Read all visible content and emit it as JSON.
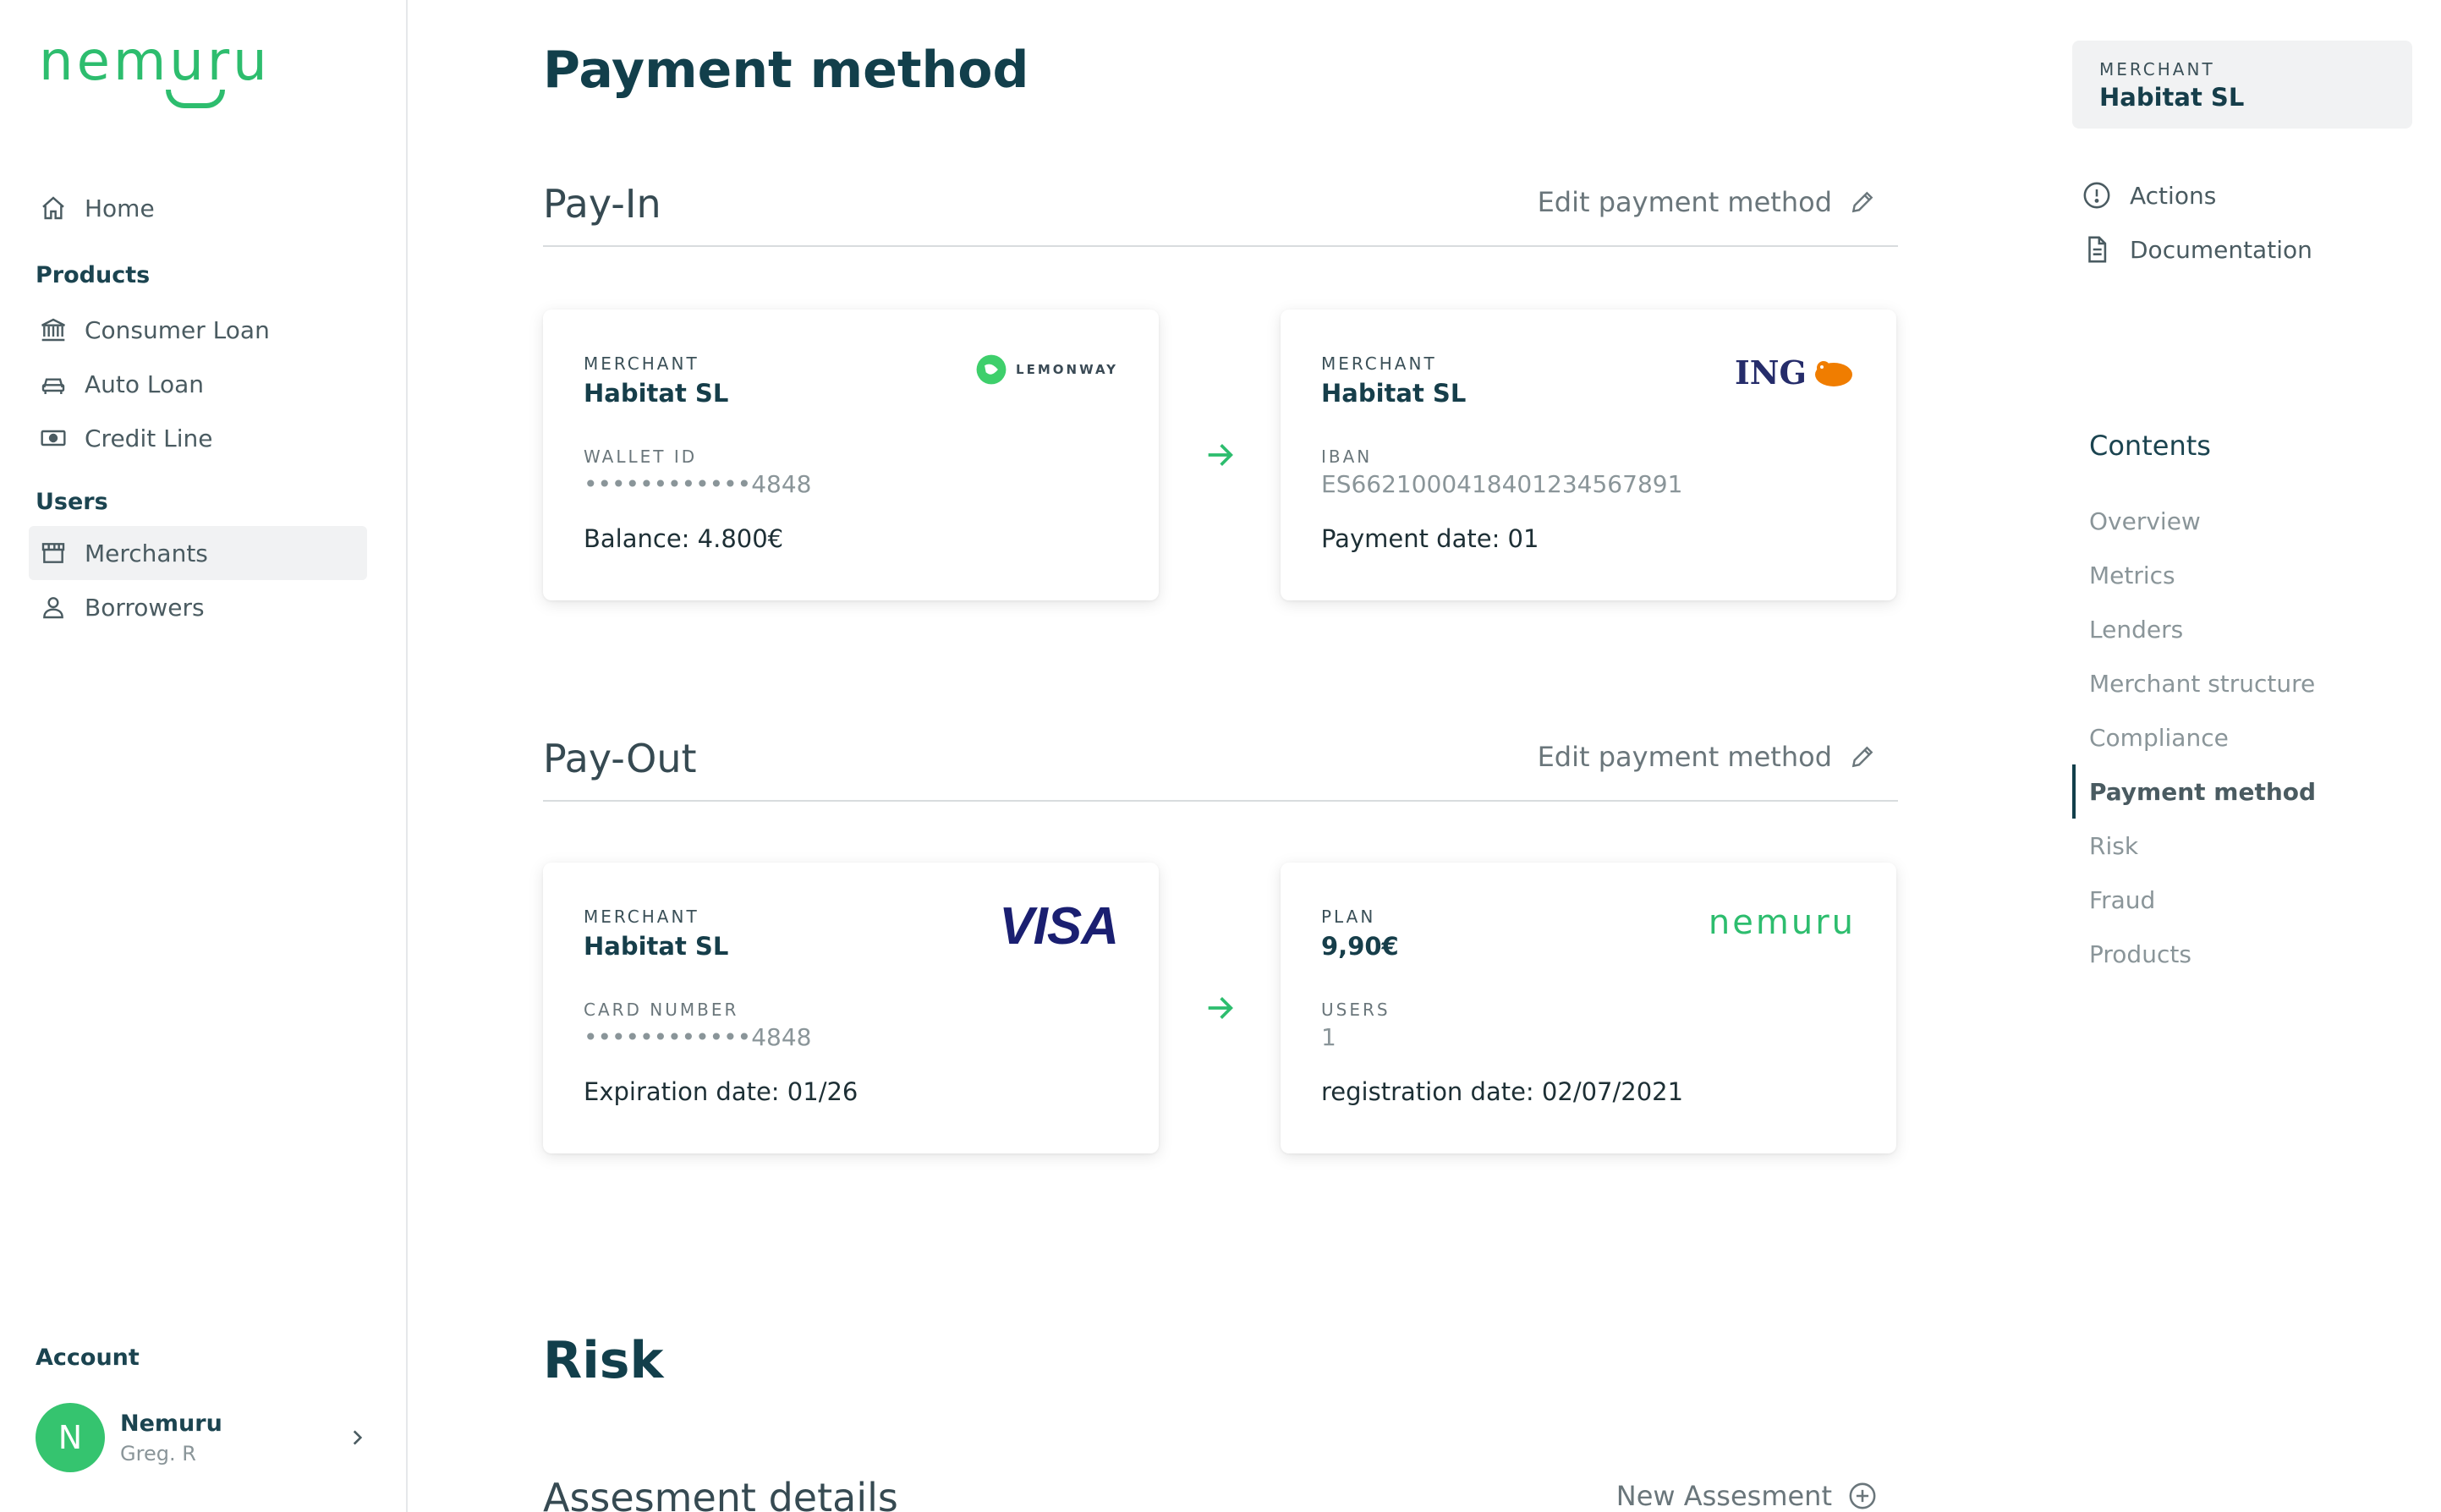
{
  "brand": {
    "logo_text": "nemuru",
    "accent": "#2dbd6e"
  },
  "sidebar": {
    "home": "Home",
    "products_title": "Products",
    "products": [
      "Consumer Loan",
      "Auto Loan",
      "Credit Line"
    ],
    "users_title": "Users",
    "users": [
      "Merchants",
      "Borrowers"
    ],
    "active_item": "Merchants",
    "account_title": "Account",
    "account": {
      "initial": "N",
      "name": "Nemuru",
      "sub": "Greg. R"
    }
  },
  "main": {
    "title": "Payment method",
    "payin": {
      "title": "Pay-In",
      "edit_label": "Edit payment method",
      "source": {
        "key1": "MERCHANT",
        "val1": "Habitat SL",
        "key2": "WALLET ID",
        "val2": "••••••••••••4848",
        "val3": "Balance: 4.800€",
        "brand": "LEMONWAY"
      },
      "target": {
        "key1": "MERCHANT",
        "val1": "Habitat SL",
        "key2": "IBAN",
        "val2": "ES6621000418401234567891",
        "val3": "Payment date: 01",
        "brand": "ING"
      }
    },
    "payout": {
      "title": "Pay-Out",
      "edit_label": "Edit payment method",
      "source": {
        "key1": "MERCHANT",
        "val1": "Habitat SL",
        "key2": "CARD NUMBER",
        "val2": "••••••••••••4848",
        "val3": "Expiration date: 01/26",
        "brand": "VISA"
      },
      "target": {
        "key1": "PLAN",
        "val1": "9,90€",
        "key2": "USERS",
        "val2": "1",
        "val3": "registration date: 02/07/2021",
        "brand": "nemuru"
      }
    },
    "risk_title": "Risk",
    "assessment": {
      "title": "Assesment details",
      "action": "New Assesment"
    }
  },
  "rail": {
    "merchant_key": "MERCHANT",
    "merchant_value": "Habitat SL",
    "links": [
      "Actions",
      "Documentation"
    ],
    "contents_title": "Contents",
    "contents": [
      "Overview",
      "Metrics",
      "Lenders",
      "Merchant structure",
      "Compliance",
      "Payment method",
      "Risk",
      "Fraud",
      "Products"
    ],
    "active_content": "Payment method"
  }
}
